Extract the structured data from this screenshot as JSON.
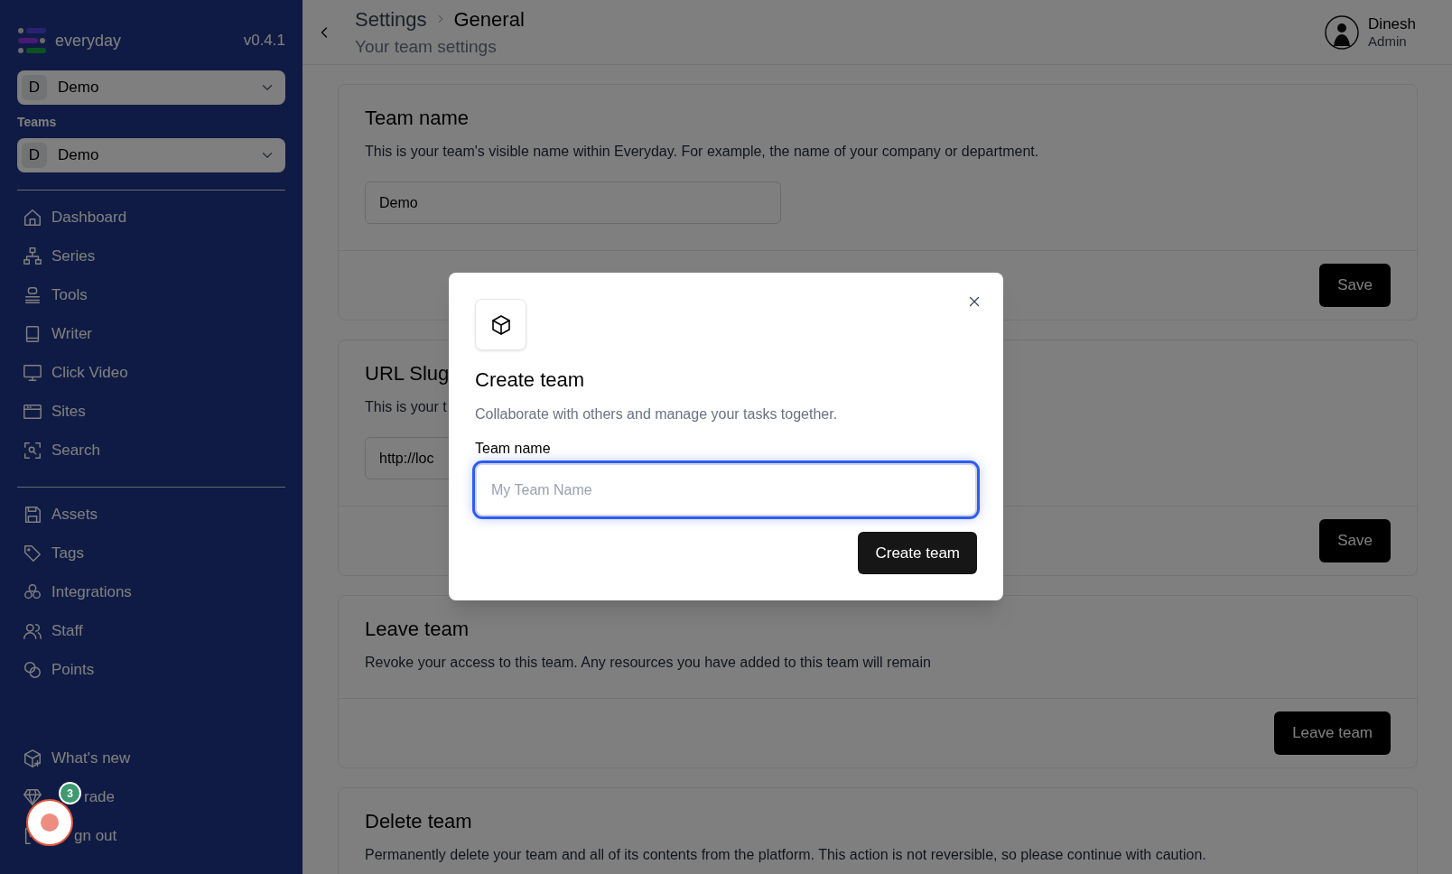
{
  "sidebar": {
    "brand": "everyday",
    "version": "v0.4.1",
    "workspace_select": {
      "initial": "D",
      "value": "Demo"
    },
    "teams_label": "Teams",
    "team_select": {
      "initial": "D",
      "value": "Demo"
    },
    "nav_groups": [
      [
        {
          "label": "Dashboard"
        },
        {
          "label": "Series"
        },
        {
          "label": "Tools"
        },
        {
          "label": "Writer"
        },
        {
          "label": "Click Video"
        },
        {
          "label": "Sites"
        },
        {
          "label": "Search"
        }
      ],
      [
        {
          "label": "Assets"
        },
        {
          "label": "Tags"
        },
        {
          "label": "Integrations"
        },
        {
          "label": "Staff"
        },
        {
          "label": "Points"
        }
      ]
    ],
    "footer_items": [
      {
        "label": "What's new"
      },
      {
        "label": "rade"
      },
      {
        "label": "gn out"
      }
    ]
  },
  "header": {
    "breadcrumb": [
      "Settings",
      "General"
    ],
    "subtitle": "Your team settings",
    "user": {
      "name": "Dinesh",
      "role": "Admin"
    }
  },
  "cards": [
    {
      "title": "Team name",
      "description": "This is your team's visible name within Everyday. For example, the name of your company or department.",
      "input_value": "Demo",
      "button": "Save"
    },
    {
      "title": "URL Slug",
      "description": "This is your t",
      "input_value": "http://loc",
      "button": "Save"
    },
    {
      "title": "Leave team",
      "description": "Revoke your access to this team. Any resources you have added to this team will remain",
      "button": "Leave team"
    },
    {
      "title": "Delete team",
      "description": "Permanently delete your team and all of its contents from the platform. This action is not reversible, so please continue with caution."
    }
  ],
  "modal": {
    "title": "Create team",
    "description": "Collaborate with others and manage your tasks together.",
    "field_label": "Team name",
    "placeholder": "My Team Name",
    "button": "Create team"
  },
  "recorder": {
    "badge": "3"
  }
}
